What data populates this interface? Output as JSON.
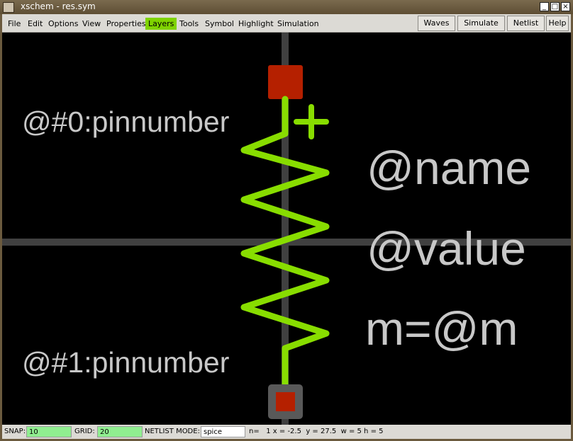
{
  "window": {
    "title": "xschem - res.sym",
    "minimize_glyph": "_",
    "maximize_glyph": "□",
    "close_glyph": "×"
  },
  "menu": {
    "items": [
      "File",
      "Edit",
      "Options",
      "View",
      "Properties",
      "Layers",
      "Tools",
      "Symbol",
      "Highlight",
      "Simulation"
    ],
    "active": "Layers"
  },
  "toolbar": {
    "waves": "Waves",
    "simulate": "Simulate",
    "netlist": "Netlist",
    "help": "Help"
  },
  "canvas": {
    "pin0_label": "@#0:pinnumber",
    "pin1_label": "@#1:pinnumber",
    "name_label": "@name",
    "value_label": "@value",
    "m_label": "m=@m",
    "plus_sign": "+",
    "colors": {
      "background": "#000000",
      "grid_axis": "#404040",
      "wire": "#88dd00",
      "pin": "#b52000",
      "text": "#c8c8c8"
    }
  },
  "status": {
    "snap_label": "SNAP:",
    "snap_value": "10",
    "grid_label": "GRID:",
    "grid_value": "20",
    "netlist_mode_label": "NETLIST MODE:",
    "netlist_mode_value": "spice",
    "coords": "n=   1 x = -2.5  y = 27.5  w = 5 h = 5"
  }
}
